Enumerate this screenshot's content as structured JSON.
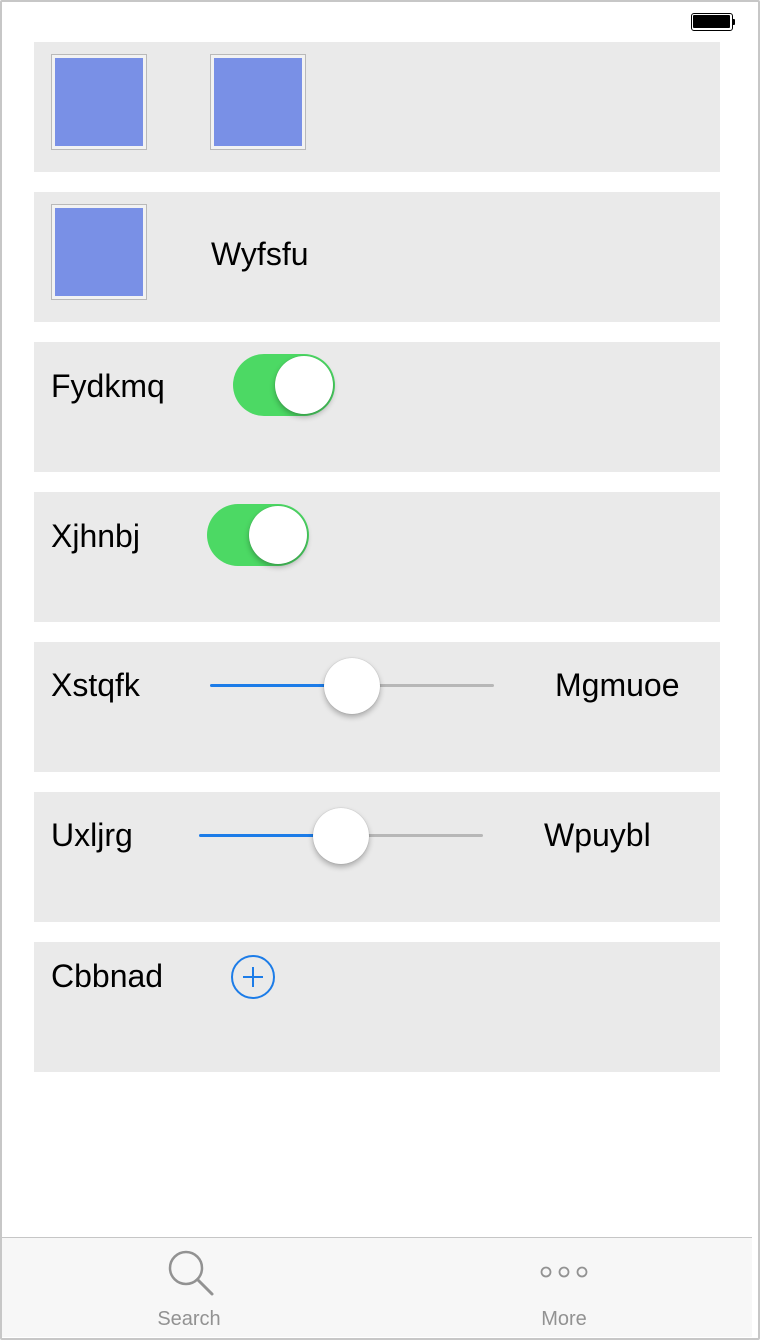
{
  "rows": {
    "row2": {
      "label": "Wyfsfu"
    },
    "row3": {
      "label": "Fydkmq",
      "switch_on": true
    },
    "row4": {
      "label": "Xjhnbj",
      "switch_on": true
    },
    "row5": {
      "min_label": "Xstqfk",
      "max_label": "Mgmuoe",
      "value": 0.5
    },
    "row6": {
      "min_label": "Uxljrg",
      "max_label": "Wpuybl",
      "value": 0.5
    },
    "row7": {
      "label": "Cbbnad"
    }
  },
  "tabbar": {
    "tabs": [
      {
        "label": "Search",
        "icon": "search-icon"
      },
      {
        "label": "More",
        "icon": "more-icon"
      }
    ]
  },
  "colors": {
    "row_bg": "#eaeaea",
    "thumb_fill": "#7990e6",
    "switch_on": "#4cd964",
    "accent": "#1c7ce8"
  }
}
